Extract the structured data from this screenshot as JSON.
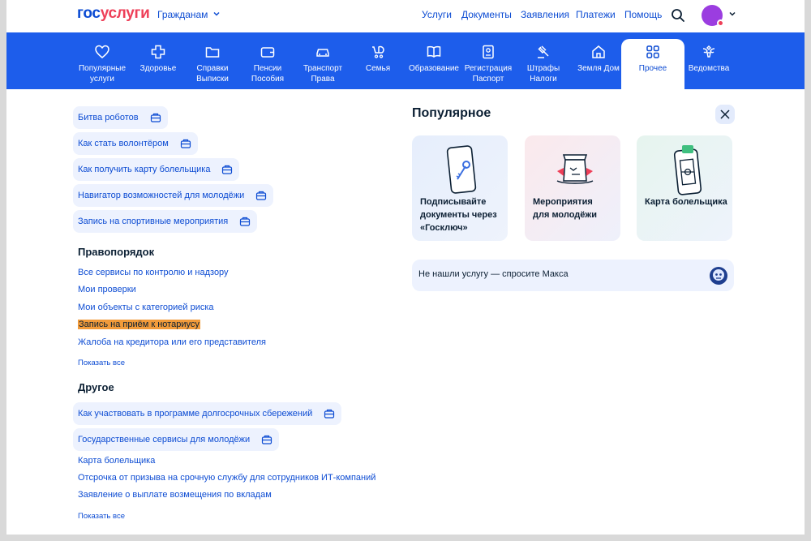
{
  "header": {
    "logo_part1": "гос",
    "logo_part2": "услуги",
    "audience": "Гражданам",
    "nav": [
      "Услуги",
      "Документы",
      "Заявления",
      "Платежи",
      "Помощь"
    ]
  },
  "categories": [
    {
      "line1": "Популярные",
      "line2": "услуги",
      "icon": "heart-icon"
    },
    {
      "line1": "Здоровье",
      "line2": "",
      "icon": "medical-cross-icon"
    },
    {
      "line1": "Справки",
      "line2": "Выписки",
      "icon": "folder-icon"
    },
    {
      "line1": "Пенсии",
      "line2": "Пособия",
      "icon": "wallet-icon"
    },
    {
      "line1": "Транспорт",
      "line2": "Права",
      "icon": "car-icon"
    },
    {
      "line1": "Семья",
      "line2": "",
      "icon": "stroller-icon"
    },
    {
      "line1": "Образование",
      "line2": "",
      "icon": "book-icon"
    },
    {
      "line1": "Регистрация",
      "line2": "Паспорт",
      "icon": "passport-icon"
    },
    {
      "line1": "Штрафы",
      "line2": "Налоги",
      "icon": "gavel-icon"
    },
    {
      "line1": "Земля Дом",
      "line2": "",
      "icon": "house-icon"
    },
    {
      "line1": "Прочее",
      "line2": "",
      "icon": "grid-icon"
    },
    {
      "line1": "Ведомства",
      "line2": "",
      "icon": "emblem-icon"
    }
  ],
  "active_category": "Прочее",
  "youth_chips": [
    "Битва роботов",
    "Как стать волонтёром",
    "Как получить карту болельщика",
    "Навигатор возможностей для молодёжи",
    "Запись на спортивные мероприятия"
  ],
  "law_section": {
    "title": "Правопорядок",
    "links": [
      "Все сервисы по контролю и надзору",
      "Мои проверки",
      "Мои объекты с категорией риска",
      "Запись на приём к нотариусу",
      "Жалоба на кредитора или его представителя"
    ],
    "highlighted": "Запись на приём к нотариусу",
    "show_all": "Показать все"
  },
  "other_section": {
    "title": "Другое",
    "chips": [
      "Как участвовать в программе долгосрочных сбережений",
      "Государственные сервисы для молодёжи"
    ],
    "links": [
      "Карта болельщика",
      "Отсрочка от призыва на срочную службу для сотрудников ИТ-компаний",
      "Заявление о выплате возмещения по вкладам"
    ],
    "show_all": "Показать все"
  },
  "popular": {
    "title": "Популярное",
    "cards": [
      {
        "line1": "Подписывайте",
        "line2": "документы через",
        "line3": "«Госключ»",
        "icon": "phone-key-icon"
      },
      {
        "line1": "Мероприятия",
        "line2": "для молодёжи",
        "line3": "",
        "icon": "event-flags-icon"
      },
      {
        "line1": "Карта болельщика",
        "line2": "",
        "line3": "",
        "icon": "phone-field-icon"
      }
    ],
    "ask_text": "Не нашли услугу — спросите Макса"
  },
  "colors": {
    "brand_blue": "#0d4cd3",
    "band_blue": "#1d5deb",
    "brand_red": "#ee3f58",
    "highlight": "#f29b3a"
  }
}
